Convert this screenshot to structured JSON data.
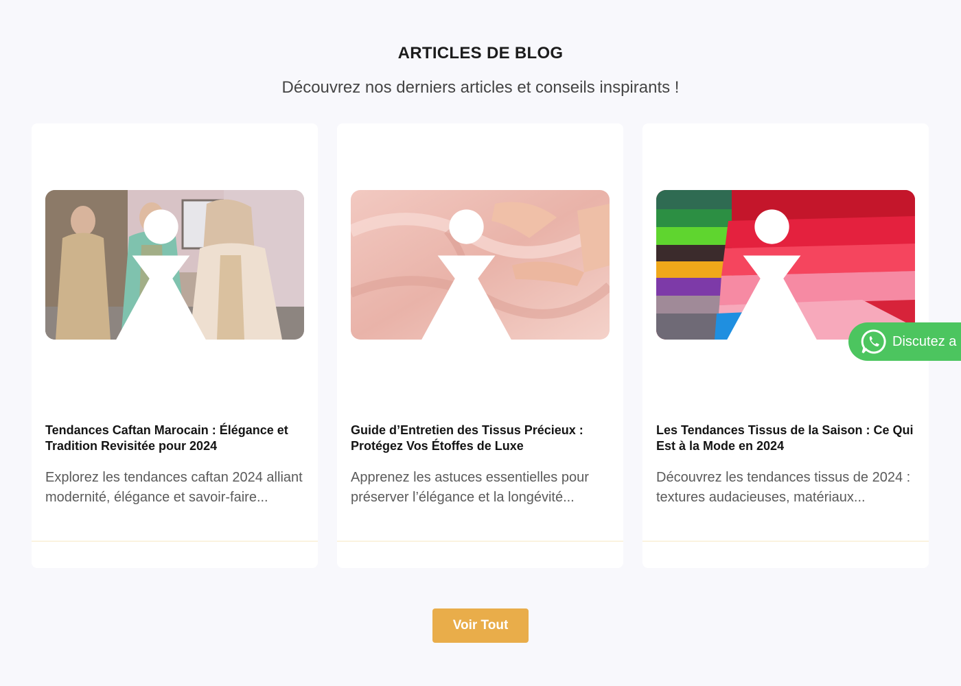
{
  "section": {
    "title": "ARTICLES DE BLOG",
    "subtitle": "Découvrez nos derniers articles et conseils inspirants !"
  },
  "articles": [
    {
      "title": "Tendances Caftan Marocain : Élégance et Tradition Revisitée pour 2024",
      "excerpt": "Explorez les tendances caftan 2024 alliant modernité, élégance et savoir-faire...",
      "image": "caftan-women-photo"
    },
    {
      "title": "Guide d’Entretien des Tissus Précieux : Protégez Vos Étoffes de Luxe",
      "excerpt": "Apprenez les astuces essentielles pour préserver l’élégance et la longévité...",
      "image": "pink-silk-fabric-photo"
    },
    {
      "title": "Les Tendances Tissus de la Saison : Ce Qui Est à la Mode en 2024",
      "excerpt": "Découvrez les tendances tissus de 2024 : textures audacieuses, matériaux...",
      "image": "colorful-satin-stack-photo"
    }
  ],
  "actions": {
    "view_all_label": "Voir Tout"
  },
  "whatsapp": {
    "label": "Discutez a",
    "icon": "whatsapp-icon"
  },
  "colors": {
    "background": "#f8f8fc",
    "card": "#ffffff",
    "accent_button": "#e9ad4a",
    "whatsapp_green": "#4cc55f"
  }
}
